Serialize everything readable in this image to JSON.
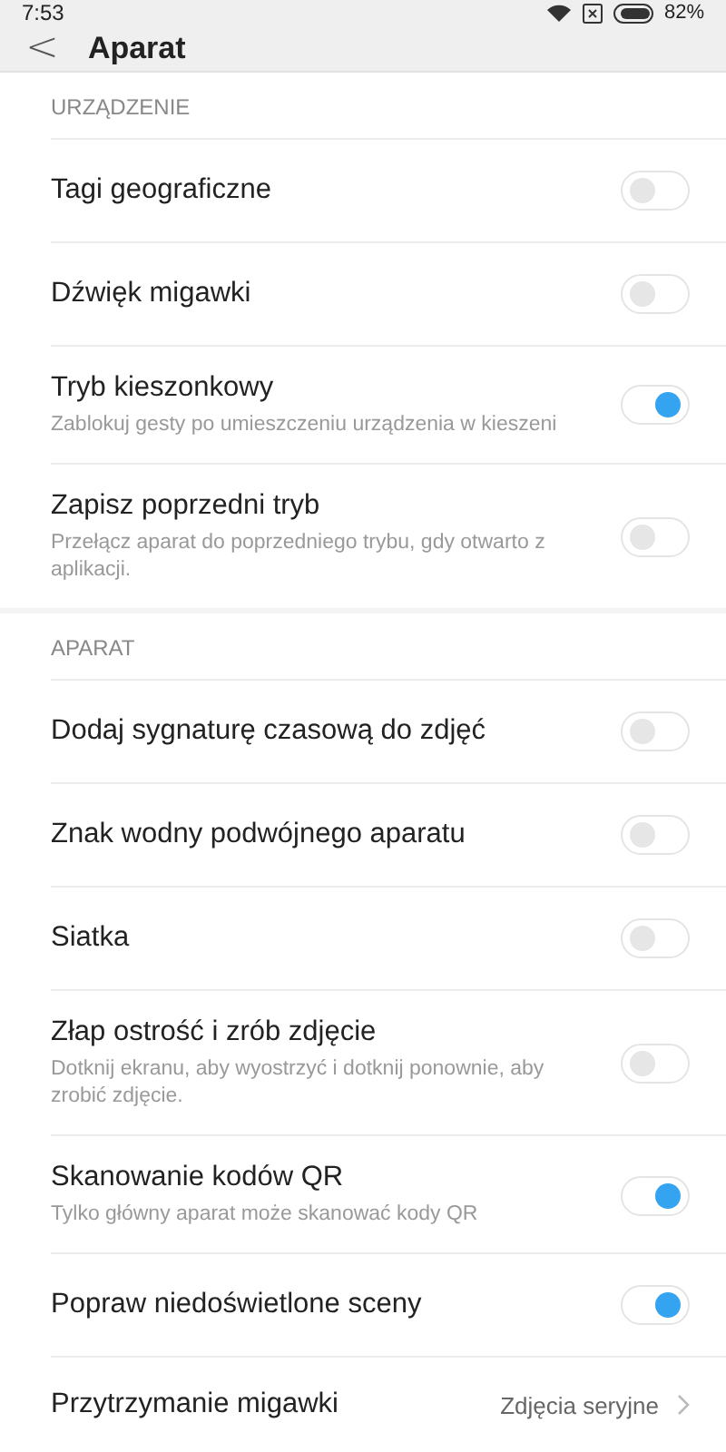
{
  "status_bar": {
    "time": "7:53",
    "battery": "82%"
  },
  "header": {
    "back": "<",
    "title": "Aparat"
  },
  "sections": [
    {
      "title": "URZĄDZENIE",
      "items": [
        {
          "kind": "toggle",
          "label": "Tagi geograficzne",
          "on": false
        },
        {
          "kind": "toggle",
          "label": "Dźwięk migawki",
          "on": false
        },
        {
          "kind": "toggle",
          "label": "Tryb kieszonkowy",
          "description": "Zablokuj gesty po umieszczeniu urządzenia w kieszeni",
          "on": true
        },
        {
          "kind": "toggle",
          "label": "Zapisz poprzedni tryb",
          "description": "Przełącz aparat do poprzedniego trybu, gdy otwarto z aplikacji.",
          "on": false
        }
      ]
    },
    {
      "title": "APARAT",
      "items": [
        {
          "kind": "toggle",
          "label": "Dodaj sygnaturę czasową do zdjęć",
          "on": false
        },
        {
          "kind": "toggle",
          "label": "Znak wodny podwójnego aparatu",
          "on": false
        },
        {
          "kind": "toggle",
          "label": "Siatka",
          "on": false
        },
        {
          "kind": "toggle",
          "label": "Złap ostrość i zrób zdjęcie",
          "description": "Dotknij ekranu, aby wyostrzyć i dotknij ponownie, aby zrobić zdjęcie.",
          "on": false
        },
        {
          "kind": "toggle",
          "label": "Skanowanie kodów QR",
          "description": "Tylko główny aparat może skanować kody QR",
          "on": true
        },
        {
          "kind": "toggle",
          "label": "Popraw niedoświetlone sceny",
          "on": true
        },
        {
          "kind": "value",
          "label": "Przytrzymanie migawki",
          "value": "Zdjęcia seryjne"
        }
      ]
    }
  ]
}
